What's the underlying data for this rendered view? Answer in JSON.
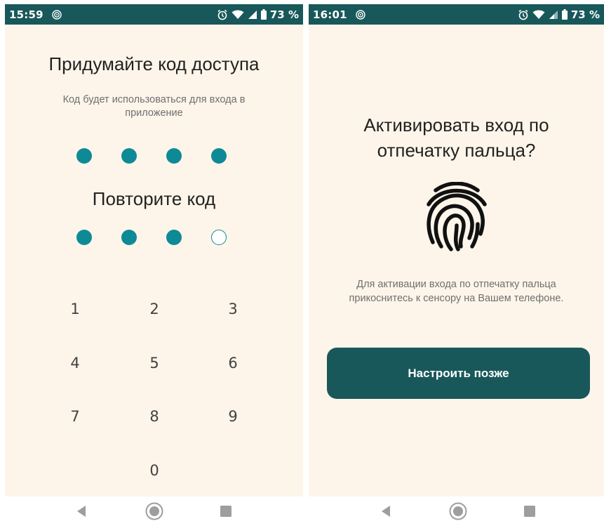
{
  "colors": {
    "status_bar": "#19585a",
    "background": "#fdf5ea",
    "accent": "#0e8a96",
    "button": "#19585a"
  },
  "left_screen": {
    "status_bar": {
      "time": "15:59",
      "battery": "73 %"
    },
    "title": "Придумайте код доступа",
    "subtitle": "Код будет использоваться для входа в приложение",
    "code_dots": [
      true,
      true,
      true,
      true
    ],
    "repeat_title": "Повторите код",
    "repeat_dots": [
      true,
      true,
      true,
      false
    ],
    "keypad": [
      "1",
      "2",
      "3",
      "4",
      "5",
      "6",
      "7",
      "8",
      "9",
      "0"
    ]
  },
  "right_screen": {
    "status_bar": {
      "time": "16:01",
      "battery": "73 %"
    },
    "title_line1": "Активировать вход по",
    "title_line2": "отпечатку пальца?",
    "icon": "fingerprint-icon",
    "description_line1": "Для активации входа по отпечатку пальца",
    "description_line2": "прикоснитесь к сенсору на Вашем телефоне.",
    "later_button": "Настроить позже"
  },
  "navigation": {
    "icons": [
      "back-icon",
      "home-icon",
      "recents-icon"
    ]
  }
}
